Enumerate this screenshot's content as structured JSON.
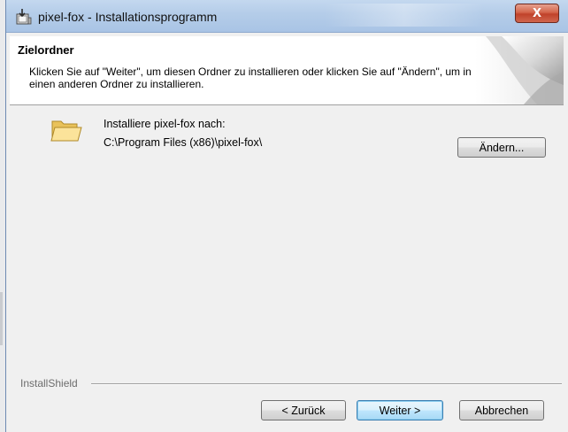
{
  "window": {
    "title": "pixel-fox - Installationsprogramm",
    "close_symbol": "X"
  },
  "banner": {
    "title": "Zielordner",
    "description": "Klicken Sie auf \"Weiter\", um diesen Ordner zu installieren oder klicken Sie auf \"Ändern\", um in einen anderen Ordner zu installieren."
  },
  "destination": {
    "label": "Installiere pixel-fox nach:",
    "path": "C:\\Program Files (x86)\\pixel-fox\\",
    "change_button": "Ändern..."
  },
  "footer": {
    "brand": "InstallShield",
    "back_button": "< Zurück",
    "next_button": "Weiter >",
    "cancel_button": "Abbrechen"
  },
  "icons": {
    "app": "installer-box-icon",
    "folder": "folder-icon",
    "close": "close-icon"
  },
  "colors": {
    "titlebar": "#b5cde9",
    "close_button": "#c9452c",
    "default_button_border": "#3c7fb1",
    "dialog_bg": "#f0f0f0"
  }
}
